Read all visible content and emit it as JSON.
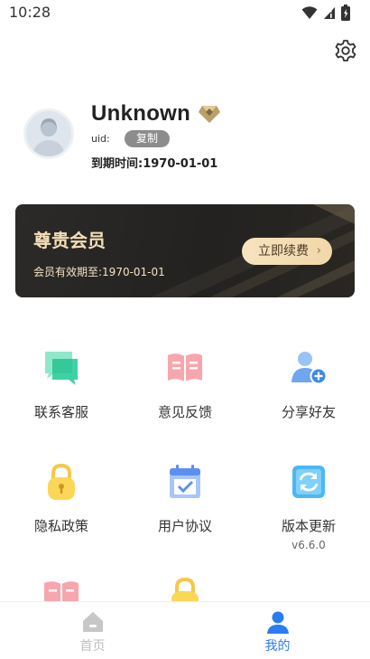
{
  "status_bar": {
    "time": "10:28"
  },
  "profile": {
    "username": "Unknown",
    "uid_label": "uid:",
    "copy_label": "复制",
    "expire_text": "到期时间:1970-01-01"
  },
  "vip_card": {
    "title": "尊贵会员",
    "expire_text": "会员有效期至:1970-01-01",
    "renew_label": "立即续费",
    "renew_icon": "chevron-right-icon"
  },
  "menu": [
    {
      "label": "联系客服",
      "icon": "chat-icon"
    },
    {
      "label": "意见反馈",
      "icon": "book-icon"
    },
    {
      "label": "分享好友",
      "icon": "add-user-icon"
    },
    {
      "label": "隐私政策",
      "icon": "lock-icon"
    },
    {
      "label": "用户协议",
      "icon": "calendar-check-icon"
    },
    {
      "label": "版本更新",
      "icon": "refresh-icon",
      "sub": "v6.6.0"
    },
    {
      "label": "",
      "icon": "book-icon"
    },
    {
      "label": "",
      "icon": "lock-icon"
    }
  ],
  "tabbar": {
    "items": [
      {
        "label": "首页",
        "icon": "home-icon",
        "active": false
      },
      {
        "label": "我的",
        "icon": "user-icon",
        "active": true
      }
    ]
  },
  "colors": {
    "accent": "#2b7cf3",
    "inactive": "#bfbfbf",
    "vip_gold": "#f4dfb8",
    "card_dark": "#262523"
  }
}
